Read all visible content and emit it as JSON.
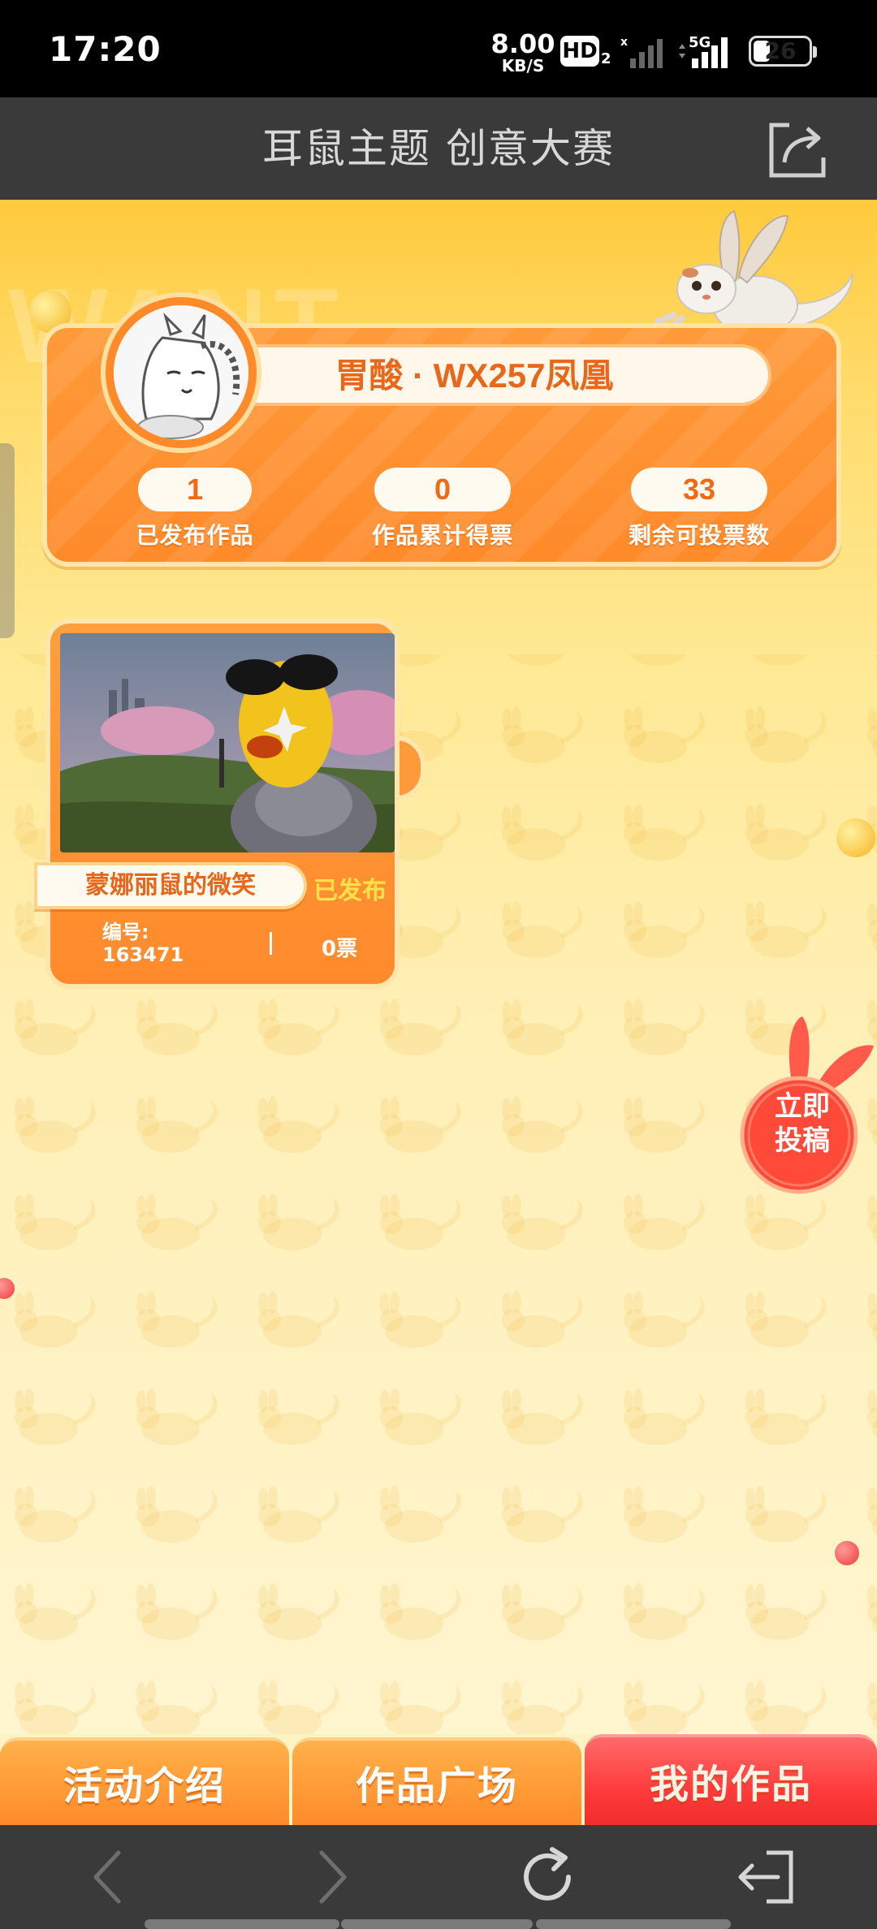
{
  "status_bar": {
    "time": "17:20",
    "net_speed_value": "8.00",
    "net_speed_unit": "KB/S",
    "hd_label": "HD",
    "hd_sub": "2",
    "network_type": "5G",
    "battery_level": "26"
  },
  "header": {
    "title": "耳鼠主题 创意大赛",
    "share_icon": "share-icon"
  },
  "profile": {
    "name": "胃酸 · WX257凤凰",
    "stats": [
      {
        "value": "1",
        "label": "已发布作品"
      },
      {
        "value": "0",
        "label": "作品累计得票"
      },
      {
        "value": "33",
        "label": "剩余可投票数"
      }
    ]
  },
  "works": [
    {
      "title": "蒙娜丽鼠的微笑",
      "status": "已发布",
      "number_label": "编号:",
      "number": "163471",
      "votes": "0票"
    }
  ],
  "submit_button": {
    "line1": "立即",
    "line2": "投稿"
  },
  "tabs": [
    {
      "label": "活动介绍",
      "active": false
    },
    {
      "label": "作品广场",
      "active": false
    },
    {
      "label": "我的作品",
      "active": true
    }
  ],
  "browser_nav": {
    "icons": [
      "back-icon",
      "forward-icon",
      "refresh-icon",
      "exit-icon"
    ]
  },
  "colors": {
    "accent_orange": "#ff8a2a",
    "active_tab_red": "#ff3b3b",
    "title_bar": "#3a3a3a",
    "name_text": "#e8671a"
  }
}
